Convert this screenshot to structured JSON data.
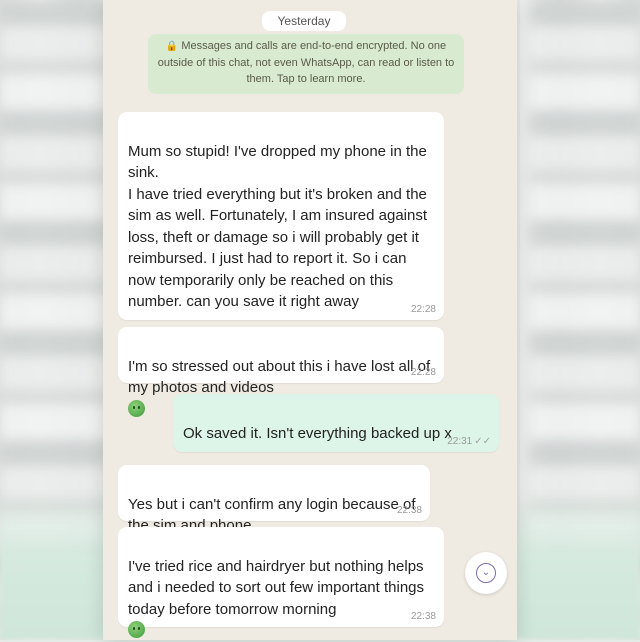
{
  "chat": {
    "date_separator": "Yesterday",
    "encryption_notice": "Messages and calls are end-to-end encrypted. No one outside of this chat, not even WhatsApp, can read or listen to them. Tap to learn more.",
    "messages": [
      {
        "direction": "incoming",
        "text": "Mum so stupid! I've dropped my phone in the sink.\nI have tried everything but it's broken and the sim as well. Fortunately, I am insured against loss, theft or damage so i will probably get it reimbursed. I just had to report it. So i can now temporarily only be reached on this number. can you save it right away",
        "time": "22:28"
      },
      {
        "direction": "incoming",
        "text": "I'm so stressed out about this i have lost all of my photos and videos",
        "time": "22:28"
      },
      {
        "direction": "outgoing",
        "text": "Ok saved it. Isn't everything backed up x",
        "time": "22:31"
      },
      {
        "direction": "incoming",
        "text": "Yes but i can't confirm any login because of the sim and phone.",
        "time": "22:38"
      },
      {
        "direction": "incoming",
        "text": "I've tried rice and hairdryer but nothing helps and i needed to sort out few important things today before tomorrow morning",
        "time": "22:38"
      }
    ]
  },
  "icons": {
    "lock": "lock-icon",
    "read_ticks": "double-check-icon",
    "emoji": "sick-face-emoji-icon",
    "scroll_down": "scroll-down-icon"
  }
}
